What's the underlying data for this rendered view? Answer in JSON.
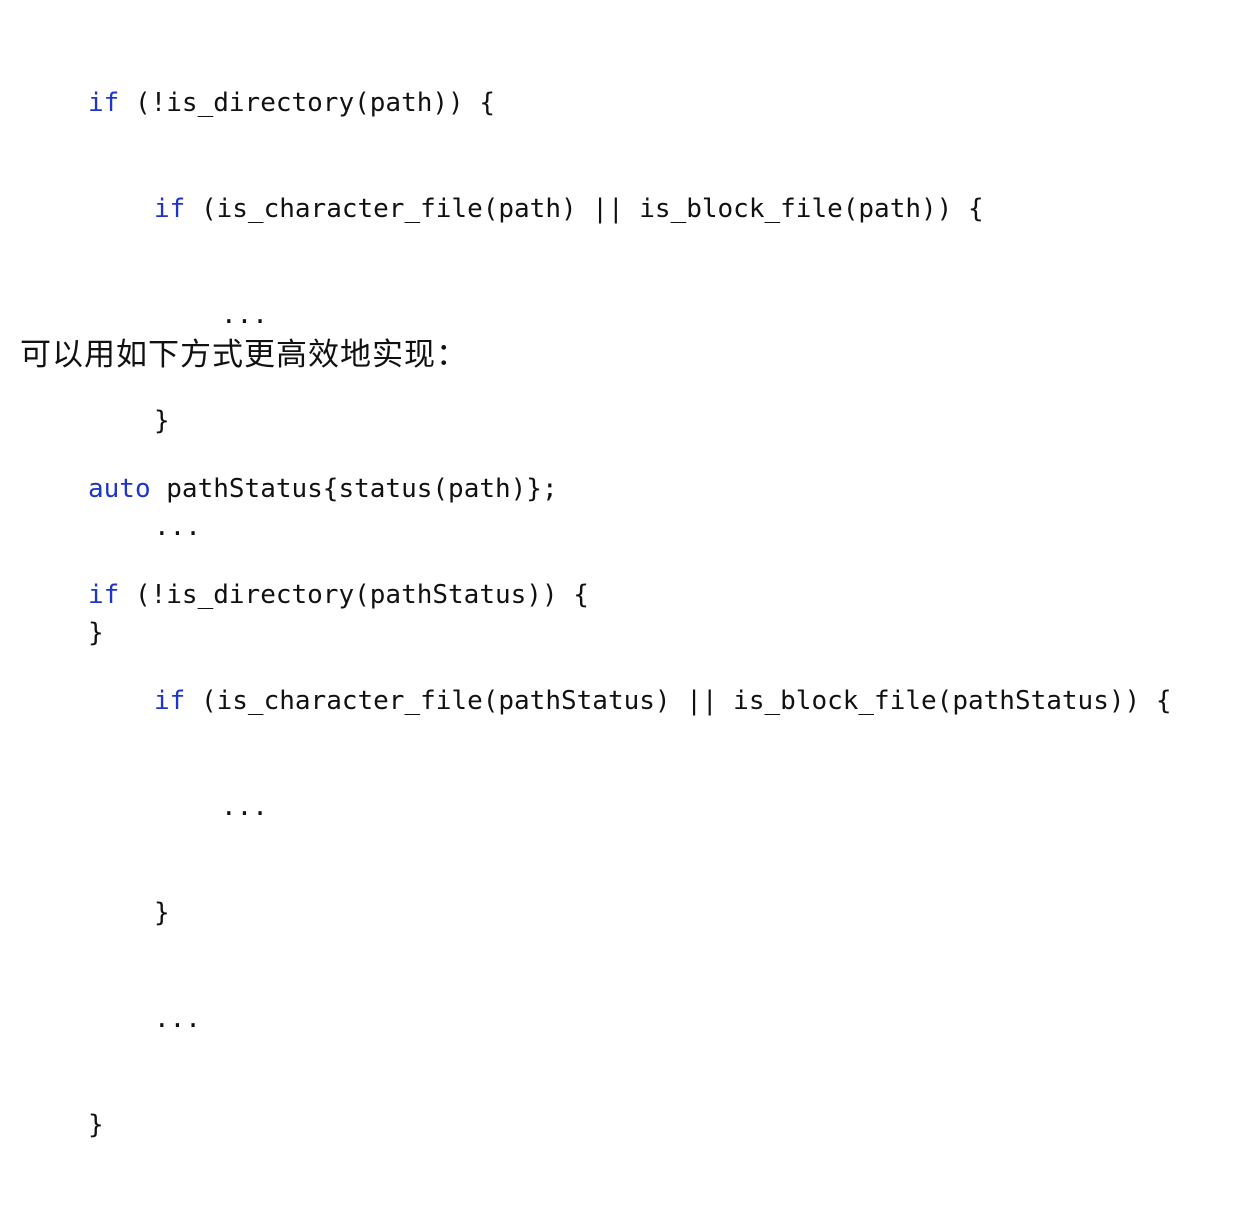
{
  "block1": {
    "l1_kw": "if",
    "l1_rest": " (!is_directory(path)) {",
    "l2_kw": "if",
    "l2_rest": " (is_character_file(path) || is_block_file(path)) {",
    "l3": "...",
    "l4": "}",
    "l5": "...",
    "l6": "}"
  },
  "prose": {
    "text": "可以用如下方式更高效地实现："
  },
  "block2": {
    "l1_kw": "auto",
    "l1_rest": " pathStatus{status(path)};",
    "l2_kw": "if",
    "l2_rest": " (!is_directory(pathStatus)) {",
    "l3_kw": "if",
    "l3_rest": " (is_character_file(pathStatus) || is_block_file(pathStatus)) {",
    "l4": "...",
    "l5": "}",
    "l6": "...",
    "l7": "}"
  },
  "colors": {
    "keyword": "#1f35c7",
    "text": "#111111",
    "background": "#ffffff"
  }
}
